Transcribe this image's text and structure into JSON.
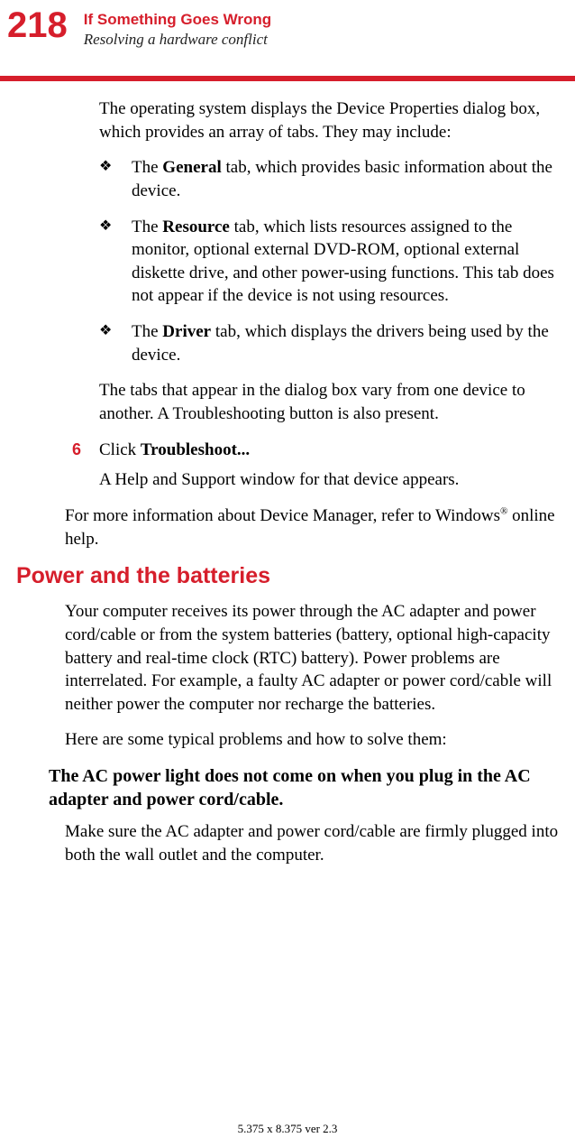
{
  "header": {
    "page_number": "218",
    "chapter_title": "If Something Goes Wrong",
    "section_subtitle": "Resolving a hardware conflict"
  },
  "intro": "The operating system displays the Device Properties dialog box, which provides an array of tabs. They may include:",
  "bullets": [
    {
      "prefix": "The ",
      "bold": "General",
      "suffix": " tab, which provides basic information about the device."
    },
    {
      "prefix": "The ",
      "bold": "Resource",
      "suffix": " tab, which lists resources assigned to the monitor, optional external DVD-ROM, optional external diskette drive, and other power-using functions. This tab does not appear if the device is not using resources."
    },
    {
      "prefix": "The ",
      "bold": "Driver",
      "suffix": " tab, which displays the drivers being used by the device."
    }
  ],
  "tabs_vary": "The tabs that appear in the dialog box vary from one device to another. A Troubleshooting button is also present.",
  "step": {
    "num": "6",
    "prefix": "Click ",
    "bold": "Troubleshoot..."
  },
  "help_window": "A Help and Support window for that device appears.",
  "more_info_prefix": "For more information about Device Manager, refer to Windows",
  "more_info_sup": "®",
  "more_info_suffix": " online help.",
  "power_heading": "Power and the batteries",
  "power_intro": "Your computer receives its power through the AC adapter and power cord/cable or from the system batteries (battery, optional high-capacity battery and real-time clock (RTC) battery). Power problems are interrelated. For example, a faulty AC adapter or power cord/cable will neither power the computer nor recharge the batteries.",
  "typical_problems": "Here are some typical problems and how to solve them:",
  "problem_heading": "The AC power light does not come on when you plug in the AC adapter and power cord/cable.",
  "problem_body": "Make sure the AC adapter and power cord/cable are firmly plugged into both the wall outlet and the computer.",
  "footer": "5.375 x 8.375 ver 2.3"
}
